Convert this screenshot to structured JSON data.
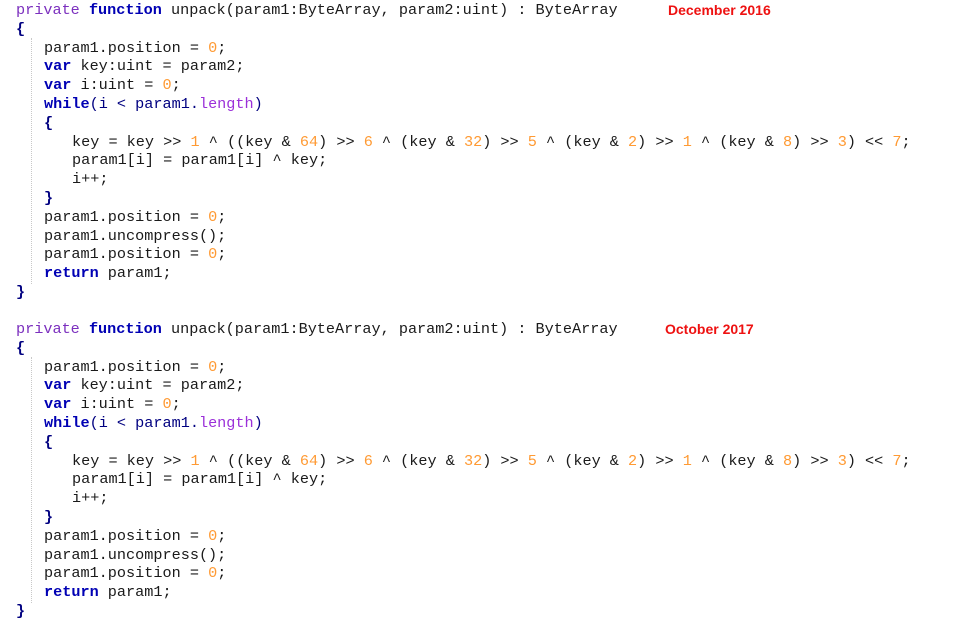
{
  "snippets": [
    {
      "label": "December 2016",
      "signature": {
        "modifier": "private",
        "keyword": "function",
        "name_and_params": "unpack(param1:ByteArray, param2:uint) : ByteArray"
      },
      "lines": {
        "open_brace": "{",
        "pos_reset_1": {
          "text": "param1.position = ",
          "num": "0",
          "end": ";"
        },
        "key_decl": {
          "kw": "var",
          "text": " key:uint = param2;"
        },
        "i_decl": {
          "kw": "var",
          "text": " i:uint = ",
          "num": "0",
          "end": ";"
        },
        "while_line": {
          "kw": "while",
          "pre": "(i < param1.",
          "prop": "length",
          "post": ")"
        },
        "loop_open": "{",
        "key_expr": {
          "p1": "key = key >> ",
          "n1": "1",
          "p2": " ^ ((key & ",
          "n2": "64",
          "p3": ") >> ",
          "n3": "6",
          "p4": " ^ (key & ",
          "n4": "32",
          "p5": ") >> ",
          "n5": "5",
          "p6": " ^ (key & ",
          "n6": "2",
          "p7": ") >> ",
          "n7": "1",
          "p8": " ^ (key & ",
          "n8": "8",
          "p9": ") >> ",
          "n9": "3",
          "p10": ") << ",
          "n10": "7",
          "end": ";"
        },
        "xor_line": "param1[i] = param1[i] ^ key;",
        "inc_line": "i++;",
        "loop_close": "}",
        "pos_reset_2": {
          "text": "param1.position = ",
          "num": "0",
          "end": ";"
        },
        "uncompress": "param1.uncompress();",
        "pos_reset_3": {
          "text": "param1.position = ",
          "num": "0",
          "end": ";"
        },
        "return_line": {
          "kw": "return",
          "text": " param1;"
        },
        "close_brace": "}"
      }
    },
    {
      "label": "October 2017",
      "signature": {
        "modifier": "private",
        "keyword": "function",
        "name_and_params": "unpack(param1:ByteArray, param2:uint) : ByteArray"
      },
      "lines": {
        "open_brace": "{",
        "pos_reset_1": {
          "text": "param1.position = ",
          "num": "0",
          "end": ";"
        },
        "key_decl": {
          "kw": "var",
          "text": " key:uint = param2;"
        },
        "i_decl": {
          "kw": "var",
          "text": " i:uint = ",
          "num": "0",
          "end": ";"
        },
        "while_line": {
          "kw": "while",
          "pre": "(i < param1.",
          "prop": "length",
          "post": ")"
        },
        "loop_open": "{",
        "key_expr": {
          "p1": "key = key >> ",
          "n1": "1",
          "p2": " ^ ((key & ",
          "n2": "64",
          "p3": ") >> ",
          "n3": "6",
          "p4": " ^ (key & ",
          "n4": "32",
          "p5": ") >> ",
          "n5": "5",
          "p6": " ^ (key & ",
          "n6": "2",
          "p7": ") >> ",
          "n7": "1",
          "p8": " ^ (key & ",
          "n8": "8",
          "p9": ") >> ",
          "n9": "3",
          "p10": ") << ",
          "n10": "7",
          "end": ";"
        },
        "xor_line": "param1[i] = param1[i] ^ key;",
        "inc_line": "i++;",
        "loop_close": "}",
        "pos_reset_2": {
          "text": "param1.position = ",
          "num": "0",
          "end": ";"
        },
        "uncompress": "param1.uncompress();",
        "pos_reset_3": {
          "text": "param1.position = ",
          "num": "0",
          "end": ";"
        },
        "return_line": {
          "kw": "return",
          "text": " param1;"
        },
        "close_brace": "}"
      }
    }
  ],
  "colors": {
    "keyword": "#0000b4",
    "modifier": "#7b2fbe",
    "number": "#ff9a33",
    "property": "#9b30d9",
    "date_label": "#ee1111"
  }
}
